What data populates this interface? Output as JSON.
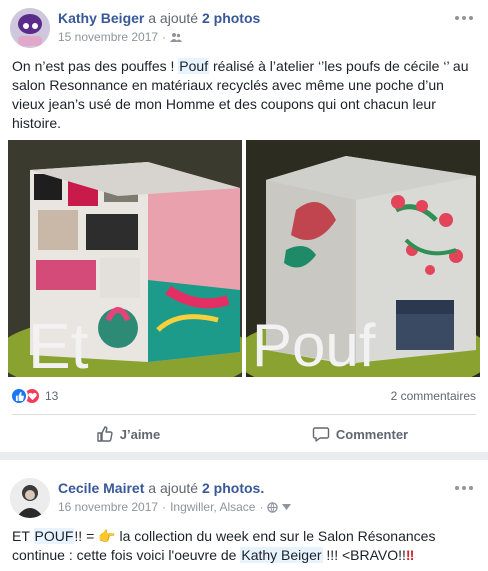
{
  "post1": {
    "author": "Kathy Beiger",
    "action": "a ajouté",
    "photos_link": "2 photos",
    "date": "15 novembre 2017",
    "body": {
      "t1": "On n’est pas des pouffes ! ",
      "mention": "Pouf",
      "t2": " réalisé à l’atelier ‘’les poufs de cécile ‘’ au salon Resonnance en matériaux recyclés avec même une poche d’un vieux jean’s usé de mon Homme et des coupons qui ont chacun leur histoire."
    },
    "photo1_text": "Et",
    "photo2_text": "Pouf",
    "reaction_count": "13",
    "comments_count": "2 commentaires",
    "like_label": "J’aime",
    "comment_label": "Commenter"
  },
  "post2": {
    "author": "Cecile Mairet",
    "action": "a ajouté",
    "photos_link": "2 photos.",
    "date": "16 novembre 2017",
    "location": "Ingwiller, Alsace",
    "body": {
      "t1": "ET ",
      "mention1": "POUF",
      "t2": "!! = ",
      "emoji": "👉",
      "t3": " la collection du week end sur le Salon Résonances continue : cette fois voici l'oeuvre de ",
      "mention2": "Kathy Beiger",
      "t4": " !!! <BRAVO!!",
      "end": "‼"
    }
  },
  "colors": {
    "link": "#385898",
    "like": "#1877f2",
    "love": "#f33e58",
    "muted": "#90949c"
  }
}
